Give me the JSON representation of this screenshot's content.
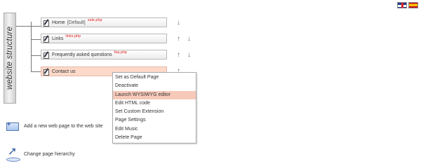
{
  "languages": [
    {
      "name": "english-flag-icon"
    },
    {
      "name": "spanish-flag-icon"
    }
  ],
  "sidebar_label": "website structure",
  "pages": [
    {
      "label": "Home",
      "tag": "[Default]",
      "file": "sale.php",
      "up": false,
      "down": true
    },
    {
      "label": "Links",
      "tag": "",
      "file": "links.php",
      "up": true,
      "down": true
    },
    {
      "label": "Frequently asked questions",
      "tag": "",
      "file": "faq.php",
      "up": true,
      "down": true
    },
    {
      "label": "Contact us",
      "tag": "",
      "file": "",
      "up": true,
      "down": false
    }
  ],
  "context_menu": {
    "items": [
      {
        "label": "Set as Default Page"
      },
      {
        "label": "Deactivate"
      },
      {
        "label": "Launch WYSIWYG editor",
        "highlighted": true
      },
      {
        "label": "Edit HTML code"
      },
      {
        "label": "Set Custom Extension"
      },
      {
        "label": "Page Settings"
      },
      {
        "label": "Edit Music"
      },
      {
        "label": "Delete Page"
      }
    ]
  },
  "actions": {
    "add_page": "Add a new web page to the web site",
    "change_hierarchy": "Change page hierarchy"
  },
  "colors": {
    "active_row": "#fcd9c9",
    "menu_highlight": "#f6c9b8",
    "file_tag": "#e02020"
  }
}
